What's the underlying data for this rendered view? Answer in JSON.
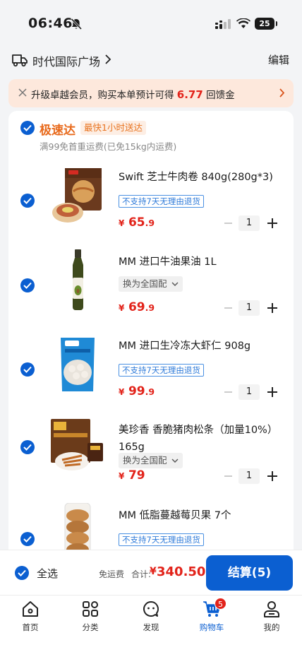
{
  "status_bar": {
    "time": "06:46",
    "battery": "25"
  },
  "address": {
    "label": "时代国际广场",
    "edit_label": "编辑"
  },
  "member_banner": {
    "text_before": "升级卓越会员，购买本单预计可得",
    "amount": "6.77",
    "text_after": "回馈金"
  },
  "shop": {
    "title": "极速达",
    "tag": "最快1小时送达",
    "subtitle": "满99免首重运费(已免15kg内运费)"
  },
  "items": [
    {
      "name": "Swift 芝士牛肉卷 840g(280g*3)",
      "tag": "不支持7天无理由退货",
      "tag_type": "blue",
      "price_yen": "¥",
      "price_int": "65",
      "price_dec": ".9",
      "qty": "1"
    },
    {
      "name": "MM 进口牛油果油 1L",
      "tag": "换为全国配",
      "tag_type": "grey",
      "price_yen": "¥",
      "price_int": "69",
      "price_dec": ".9",
      "qty": "1"
    },
    {
      "name": "MM 进口生冷冻大虾仁 908g",
      "tag": "不支持7天无理由退货",
      "tag_type": "blue",
      "price_yen": "¥",
      "price_int": "99",
      "price_dec": ".9",
      "qty": "1"
    },
    {
      "name": "美珍香 香脆猪肉松条（加量10%）165g",
      "tag": "换为全国配",
      "tag_type": "grey",
      "price_yen": "¥",
      "price_int": "79",
      "price_dec": "",
      "qty": "1"
    },
    {
      "name": "MM 低脂蔓越莓贝果 7个",
      "tag": "不支持7天无理由退货",
      "tag_type": "blue",
      "price_yen": "",
      "price_int": "",
      "price_dec": "",
      "qty": ""
    }
  ],
  "bottom_bar": {
    "select_all": "全选",
    "free_shipping": "免运费",
    "total_label": "合计:",
    "total_yen": "¥",
    "total_amount": "340.50",
    "checkout": "结算(5)"
  },
  "tabs": [
    {
      "label": "首页",
      "icon": "home-icon"
    },
    {
      "label": "分类",
      "icon": "category-icon"
    },
    {
      "label": "发现",
      "icon": "discover-icon"
    },
    {
      "label": "购物车",
      "icon": "cart-icon",
      "badge": "5",
      "active": true
    },
    {
      "label": "我的",
      "icon": "profile-icon"
    }
  ],
  "colors": {
    "accent": "#0b5fd1",
    "price": "#e2231a",
    "express": "#e86a1c"
  }
}
